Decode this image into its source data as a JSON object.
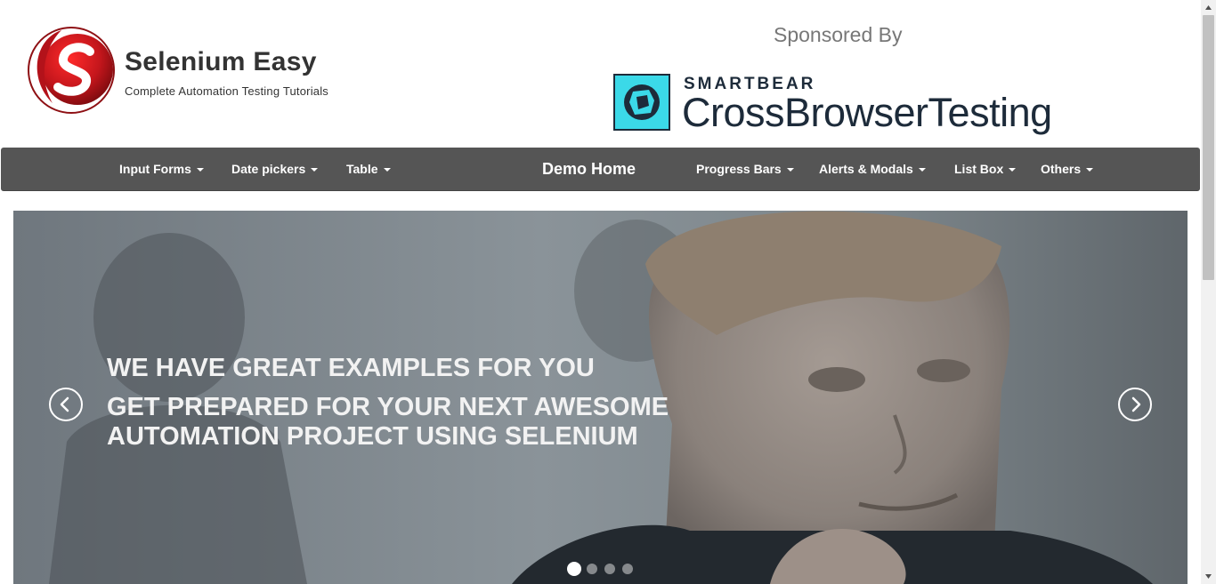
{
  "header": {
    "brand_name": "Selenium Easy",
    "brand_tagline": "Complete Automation Testing Tutorials",
    "sponsor_text": "Sponsored By",
    "sponsor_company": "SMARTBEAR",
    "sponsor_product": "CrossBrowserTesting"
  },
  "nav": {
    "items": [
      {
        "label": "Input Forms"
      },
      {
        "label": "Date pickers"
      },
      {
        "label": "Table"
      },
      {
        "label": "Demo Home"
      },
      {
        "label": "Progress Bars"
      },
      {
        "label": "Alerts & Modals"
      },
      {
        "label": "List Box"
      },
      {
        "label": "Others"
      }
    ]
  },
  "carousel": {
    "caption_line1": "WE HAVE GREAT EXAMPLES FOR YOU",
    "caption_line2": "GET PREPARED FOR YOUR NEXT AWESOME",
    "caption_line3": "AUTOMATION PROJECT USING SELENIUM",
    "prev_icon": "chevron-left-icon",
    "next_icon": "chevron-right-icon",
    "slide_count": 4,
    "active_slide": 1
  },
  "colors": {
    "navbar": "#555555",
    "logo_red": "#c4161c",
    "smartbear_teal": "#3bd9e8",
    "sponsor_dark": "#1d2b3a"
  }
}
